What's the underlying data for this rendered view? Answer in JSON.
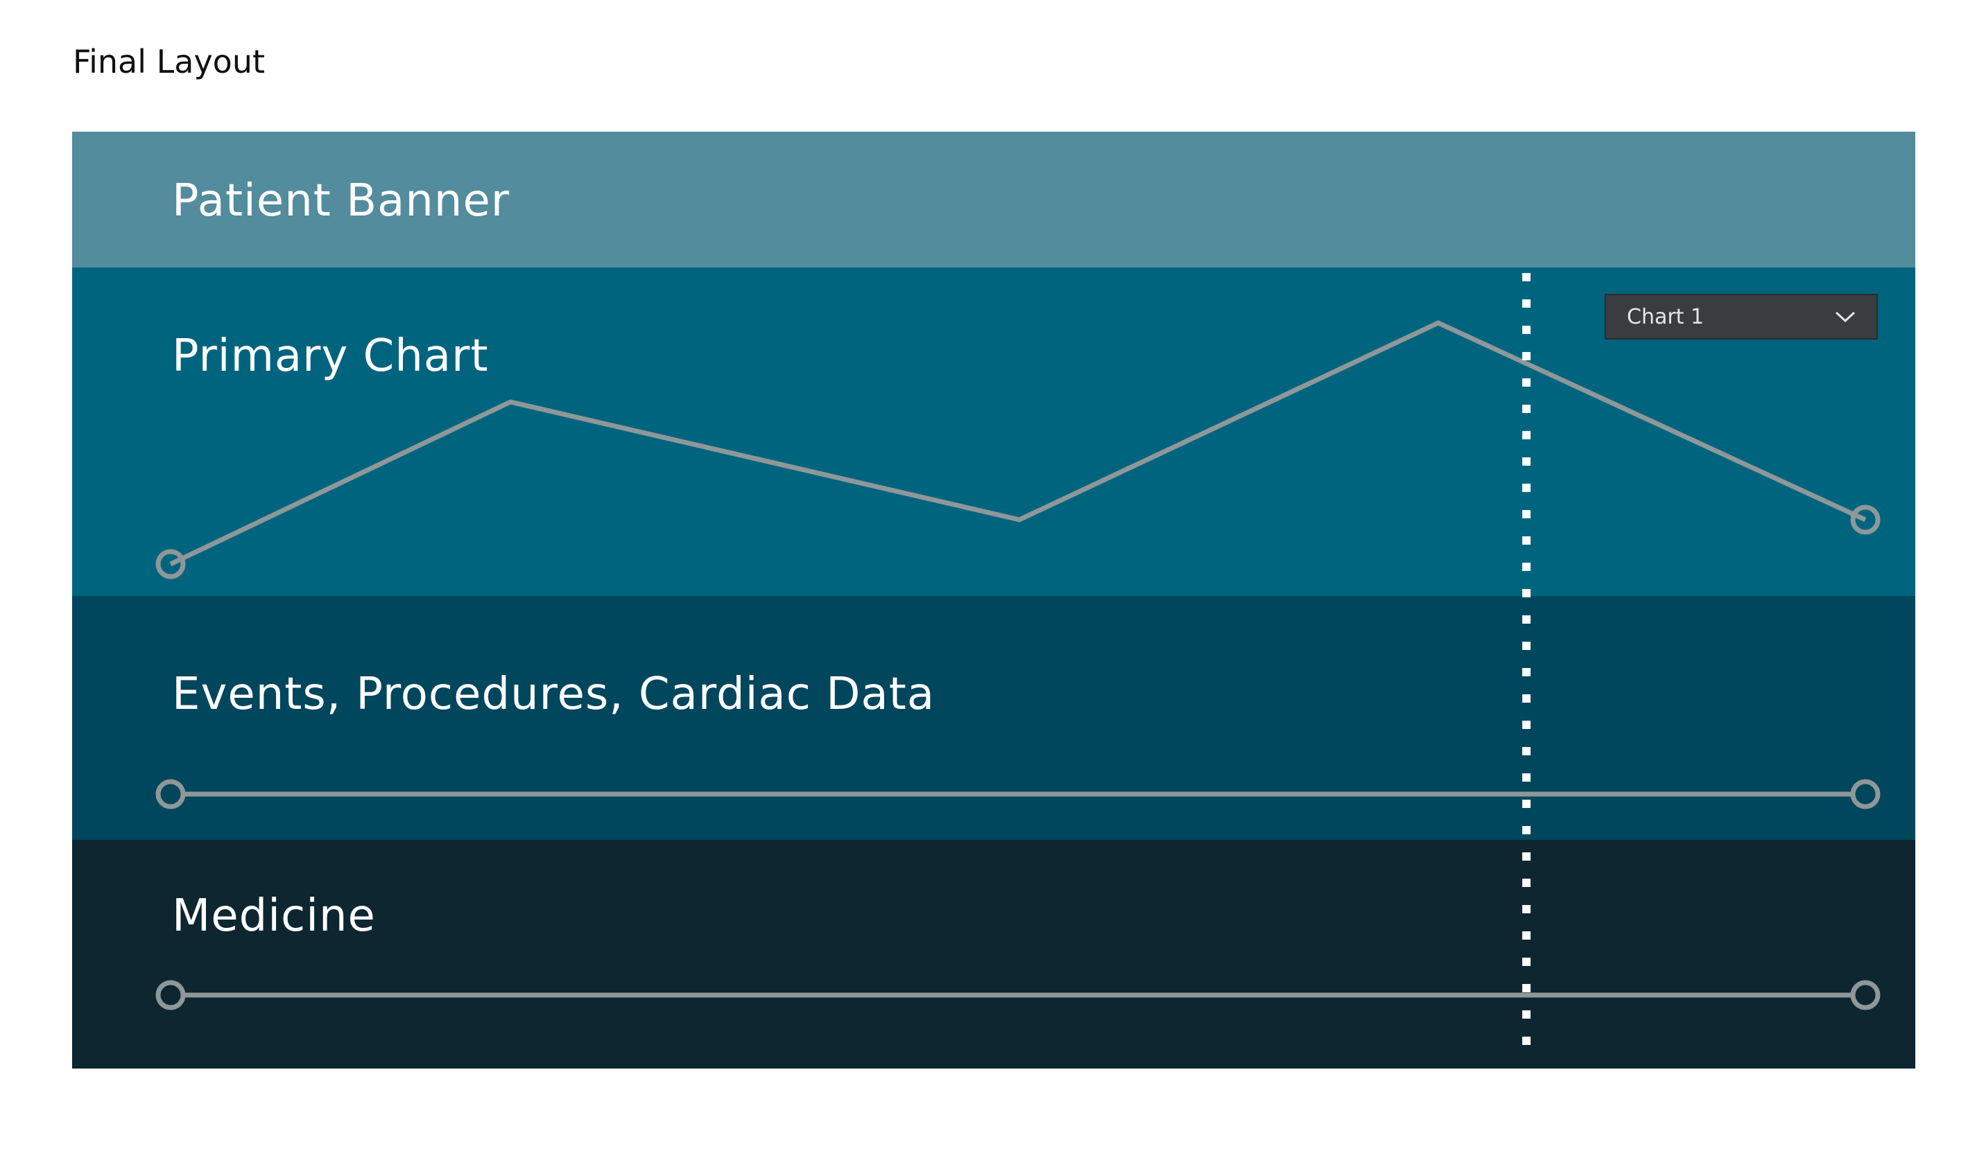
{
  "page": {
    "title": "Final Layout"
  },
  "colors": {
    "banner": "#538c9d",
    "primary": "#01647f",
    "events": "#00465d",
    "medicine": "#0d2630",
    "line": "#8e9898",
    "marker": "#ffffff",
    "dropdown": "#3a3d40"
  },
  "bands": {
    "banner": {
      "label": "Patient Banner"
    },
    "primary": {
      "label": "Primary Chart"
    },
    "events": {
      "label": "Events, Procedures, Cardiac Data"
    },
    "medicine": {
      "label": "Medicine"
    }
  },
  "dropdown": {
    "selected": "Chart 1",
    "icon": "chevron-down-icon"
  },
  "time_marker": {
    "style": "dotted",
    "position_fraction": 0.8
  }
}
